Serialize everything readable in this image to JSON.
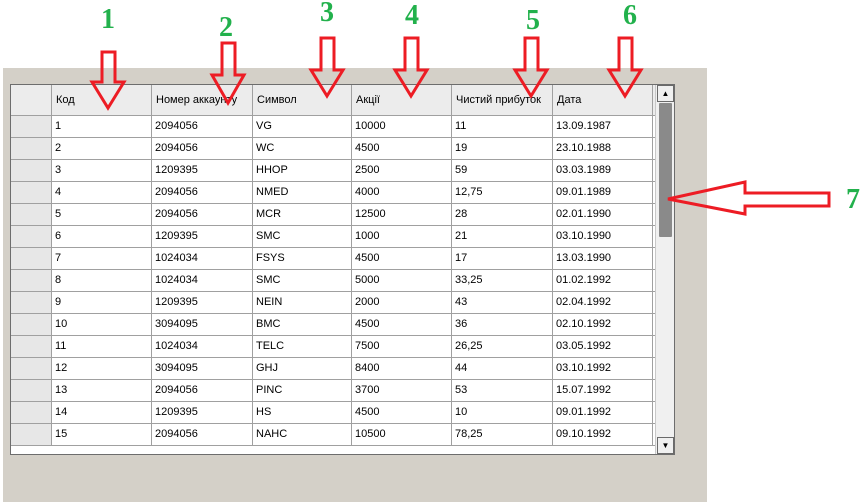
{
  "annotations": {
    "numbers": [
      "1",
      "2",
      "3",
      "4",
      "5",
      "6",
      "7"
    ],
    "arrow_color": "#ed1c24",
    "number_color": "#22b14c"
  },
  "grid": {
    "columns": [
      {
        "label": "Код"
      },
      {
        "label": "Номер аккаунту"
      },
      {
        "label": "Символ"
      },
      {
        "label": "Акції"
      },
      {
        "label": "Чистий прибуток"
      },
      {
        "label": "Дата"
      }
    ],
    "rows": [
      [
        "1",
        "2094056",
        "VG",
        "10000",
        "11",
        "13.09.1987"
      ],
      [
        "2",
        "2094056",
        "WC",
        "4500",
        "19",
        "23.10.1988"
      ],
      [
        "3",
        "1209395",
        "HHOP",
        "2500",
        "59",
        "03.03.1989"
      ],
      [
        "4",
        "2094056",
        "NMED",
        "4000",
        "12,75",
        "09.01.1989"
      ],
      [
        "5",
        "2094056",
        "MCR",
        "12500",
        "28",
        "02.01.1990"
      ],
      [
        "6",
        "1209395",
        "SMC",
        "1000",
        "21",
        "03.10.1990"
      ],
      [
        "7",
        "1024034",
        "FSYS",
        "4500",
        "17",
        "13.03.1990"
      ],
      [
        "8",
        "1024034",
        "SMC",
        "5000",
        "33,25",
        "01.02.1992"
      ],
      [
        "9",
        "1209395",
        "NEIN",
        "2000",
        "43",
        "02.04.1992"
      ],
      [
        "10",
        "3094095",
        "BMC",
        "4500",
        "36",
        "02.10.1992"
      ],
      [
        "11",
        "1024034",
        "TELC",
        "7500",
        "26,25",
        "03.05.1992"
      ],
      [
        "12",
        "3094095",
        "GHJ",
        "8400",
        "44",
        "03.10.1992"
      ],
      [
        "13",
        "2094056",
        "PINC",
        "3700",
        "53",
        "15.07.1992"
      ],
      [
        "14",
        "1209395",
        "HS",
        "4500",
        "10",
        "09.01.1992"
      ],
      [
        "15",
        "2094056",
        "NAHC",
        "10500",
        "78,25",
        "09.10.1992"
      ]
    ]
  },
  "scrollbar": {
    "up_icon": "triangle-up-icon",
    "down_icon": "triangle-down-icon"
  }
}
